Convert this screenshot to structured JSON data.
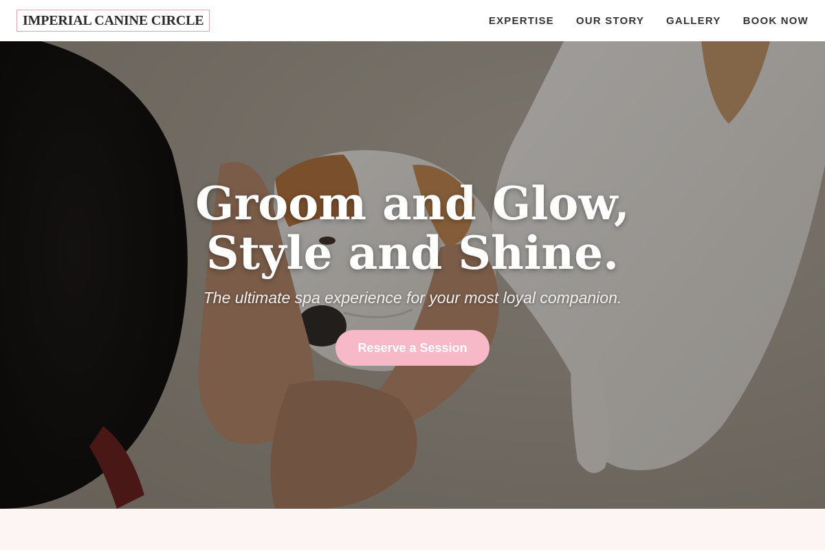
{
  "header": {
    "logo": "IMPERIAL CANINE CIRCLE",
    "nav": [
      {
        "label": "EXPERTISE"
      },
      {
        "label": "OUR STORY"
      },
      {
        "label": "GALLERY"
      },
      {
        "label": "BOOK NOW"
      }
    ]
  },
  "hero": {
    "headline_line1": "Groom and Glow,",
    "headline_line2": "Style and Shine.",
    "tagline": "The ultimate spa experience for your most loyal companion.",
    "cta_label": "Reserve a Session",
    "image_subject": "person cradling a white-and-brown puppy's face in both hands"
  },
  "colors": {
    "accent": "#f7b9c8",
    "logo_border": "#d9a7ae",
    "page_background": "#fdf4f4",
    "header_background": "#ffffff",
    "nav_text": "#333333"
  }
}
